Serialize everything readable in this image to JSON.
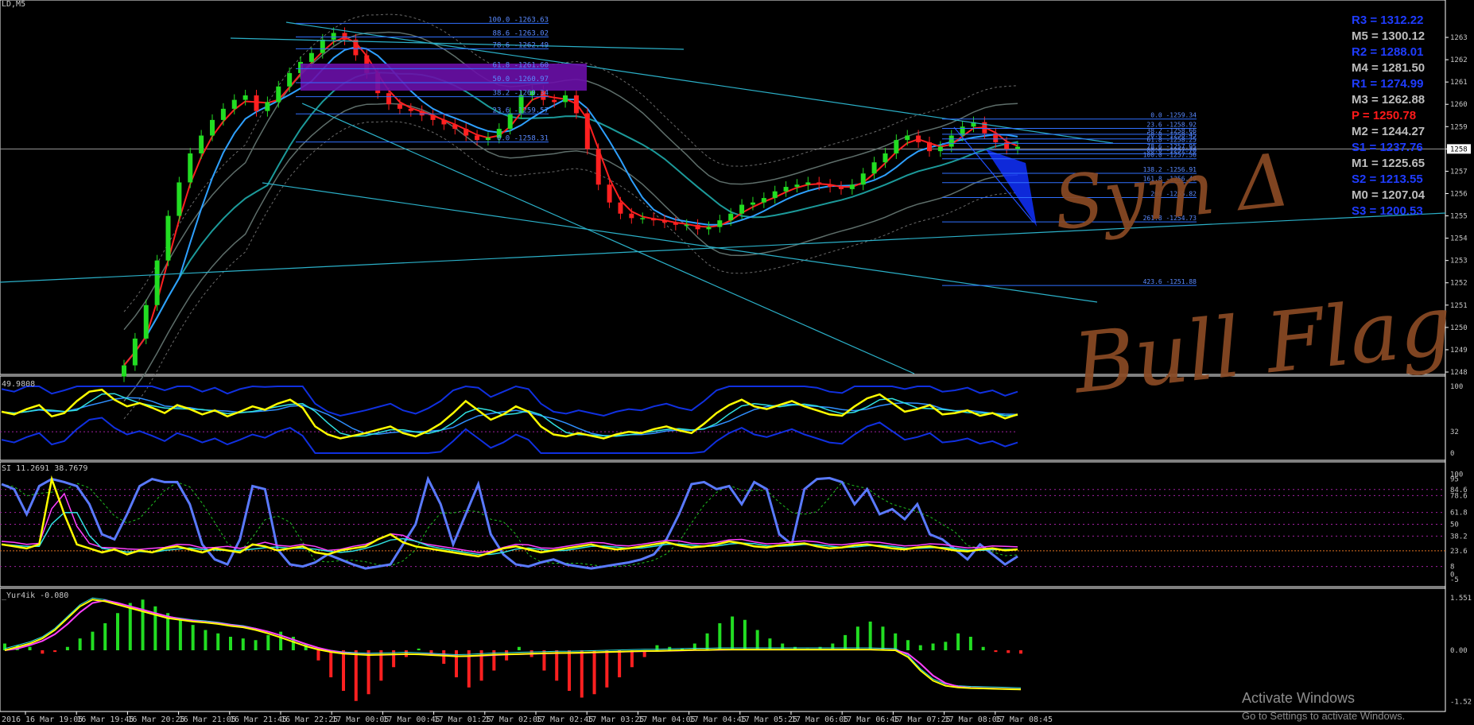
{
  "window": {
    "symbol_label": "LD,M5"
  },
  "panels": {
    "stoch_label": "49.9808",
    "rsi_label": "SI 11.2691 38.7679",
    "macd_label": "_Yur4ik -0.080"
  },
  "pivots": [
    {
      "label": "R3 = 1312.22",
      "color": "#1f3cff"
    },
    {
      "label": "M5 = 1300.12",
      "color": "#bdbdbd"
    },
    {
      "label": "R2 = 1288.01",
      "color": "#1f3cff"
    },
    {
      "label": "M4 = 1281.50",
      "color": "#bdbdbd"
    },
    {
      "label": "R1 = 1274.99",
      "color": "#1f3cff"
    },
    {
      "label": "M3 = 1262.88",
      "color": "#bdbdbd"
    },
    {
      "label": "P    = 1250.78",
      "color": "#ff1a1a"
    },
    {
      "label": "M2 = 1244.27",
      "color": "#bdbdbd"
    },
    {
      "label": "S1 = 1237.76",
      "color": "#1f3cff"
    },
    {
      "label": "M1 = 1225.65",
      "color": "#bdbdbd"
    },
    {
      "label": "S2 = 1213.55",
      "color": "#1f3cff"
    },
    {
      "label": "M0 = 1207.04",
      "color": "#bdbdbd"
    },
    {
      "label": "S3 = 1200.53",
      "color": "#1f3cff"
    }
  ],
  "annotations": {
    "line1": "Sym Δ",
    "line2": "Bull Flag"
  },
  "watermark": {
    "title": "Activate Windows",
    "subtitle": "Go to Settings to activate Windows."
  },
  "chart_data": {
    "type": "candlestick",
    "timeframe": "M5",
    "price_axis": {
      "ticks": [
        "1263",
        "1262",
        "1261",
        "1260",
        "1259",
        "1258",
        "1257",
        "1256",
        "1255",
        "1254",
        "1253",
        "1252",
        "1251",
        "1250",
        "1249",
        "1248"
      ],
      "current_price": "1258"
    },
    "time_axis": {
      "ticks": [
        "2016",
        "16 Mar 19:05",
        "16 Mar 19:45",
        "16 Mar 20:25",
        "16 Mar 21:05",
        "16 Mar 21:45",
        "16 Mar 22:25",
        "17 Mar 00:05",
        "17 Mar 00:45",
        "17 Mar 01:25",
        "17 Mar 02:05",
        "17 Mar 02:45",
        "17 Mar 03:25",
        "17 Mar 04:05",
        "17 Mar 04:45",
        "17 Mar 05:25",
        "17 Mar 06:05",
        "17 Mar 06:45",
        "17 Mar 07:25",
        "17 Mar 08:05",
        "17 Mar 08:45"
      ]
    },
    "close_path": [
      1248.3,
      1249.5,
      1251.0,
      1253.0,
      1255.0,
      1256.5,
      1257.8,
      1258.6,
      1259.3,
      1259.8,
      1260.2,
      1260.4,
      1259.7,
      1260.1,
      1260.8,
      1261.4,
      1261.9,
      1262.3,
      1262.9,
      1263.2,
      1262.9,
      1262.2,
      1261.4,
      1260.5,
      1260.0,
      1259.8,
      1259.7,
      1259.5,
      1259.3,
      1259.1,
      1258.9,
      1258.6,
      1258.4,
      1258.5,
      1258.9,
      1259.6,
      1260.4,
      1260.6,
      1260.2,
      1260.1,
      1260.4,
      1259.6,
      1258.0,
      1256.4,
      1255.6,
      1255.1,
      1254.9,
      1254.9,
      1254.8,
      1254.7,
      1254.6,
      1254.6,
      1254.4,
      1254.5,
      1254.8,
      1255.1,
      1255.5,
      1255.6,
      1255.8,
      1256.1,
      1256.3,
      1256.4,
      1256.5,
      1256.4,
      1256.3,
      1256.2,
      1256.4,
      1256.9,
      1257.4,
      1257.8,
      1258.4,
      1258.6,
      1258.3,
      1257.9,
      1258.1,
      1258.6,
      1259.0,
      1259.2,
      1258.7,
      1258.3,
      1258.0,
      1258.1
    ],
    "fibonacci_upper": [
      {
        "label": "100.0 -1263.63",
        "price": 1263.63
      },
      {
        "label": "88.6 -1263.02",
        "price": 1263.02
      },
      {
        "label": "78.6 -1262.49",
        "price": 1262.49
      },
      {
        "label": "61.8 -1261.60",
        "price": 1261.6
      },
      {
        "label": "50.0 -1260.97",
        "price": 1260.97
      },
      {
        "label": "38.2 -1260.34",
        "price": 1260.34
      },
      {
        "label": "23.6 -1259.57",
        "price": 1259.57
      },
      {
        "label": "0.0 -1258.31",
        "price": 1258.31
      }
    ],
    "fibonacci_lower": [
      {
        "label": "0.0 -1259.34",
        "price": 1259.34
      },
      {
        "label": "23.6 -1258.92",
        "price": 1258.92
      },
      {
        "label": "38.2 -1258.66",
        "price": 1258.66
      },
      {
        "label": "50.0 -1258.45",
        "price": 1258.45
      },
      {
        "label": "61.8 -1258.25",
        "price": 1258.25
      },
      {
        "label": "78.6 -1257.95",
        "price": 1257.95
      },
      {
        "label": "88.6 -1257.78",
        "price": 1257.78
      },
      {
        "label": "100.0 -1257.56",
        "price": 1257.56
      },
      {
        "label": "138.2 -1256.91",
        "price": 1256.91
      },
      {
        "label": "161.8 -1256.49",
        "price": 1256.49
      },
      {
        "label": "200 -1255.82",
        "price": 1255.82
      },
      {
        "label": "261.8 -1254.73",
        "price": 1254.73
      },
      {
        "label": "423.6 -1251.88",
        "price": 1251.88
      }
    ],
    "stoch": {
      "ticks": [
        "100",
        "32",
        "0"
      ],
      "path": [
        62,
        58,
        66,
        72,
        55,
        60,
        78,
        92,
        95,
        80,
        70,
        75,
        68,
        60,
        72,
        66,
        58,
        64,
        55,
        62,
        70,
        65,
        74,
        80,
        68,
        40,
        28,
        22,
        26,
        30,
        35,
        40,
        30,
        25,
        33,
        44,
        60,
        78,
        64,
        50,
        58,
        70,
        62,
        40,
        28,
        25,
        30,
        26,
        22,
        28,
        32,
        30,
        36,
        40,
        34,
        30,
        44,
        60,
        72,
        80,
        70,
        66,
        72,
        78,
        70,
        64,
        58,
        56,
        70,
        82,
        88,
        75,
        62,
        66,
        72,
        58,
        60,
        64,
        56,
        60,
        52,
        58
      ]
    },
    "rsi": {
      "ticks": [
        "100",
        "95",
        "84.6",
        "78.6",
        "61.8",
        "50",
        "38.2",
        "23.6",
        "8",
        "0",
        "-5"
      ],
      "path": [
        90,
        85,
        60,
        88,
        95,
        92,
        88,
        70,
        40,
        35,
        60,
        88,
        95,
        92,
        92,
        70,
        30,
        15,
        10,
        35,
        88,
        85,
        25,
        10,
        8,
        12,
        20,
        15,
        10,
        6,
        8,
        10,
        30,
        50,
        95,
        70,
        30,
        60,
        90,
        40,
        20,
        10,
        8,
        12,
        15,
        10,
        8,
        6,
        8,
        10,
        12,
        15,
        20,
        35,
        60,
        90,
        92,
        85,
        88,
        70,
        92,
        85,
        40,
        30,
        85,
        95,
        96,
        92,
        70,
        85,
        60,
        65,
        55,
        70,
        40,
        35,
        25,
        15,
        30,
        20,
        10,
        18
      ],
      "yellow": [
        30,
        28,
        26,
        30,
        95,
        60,
        30,
        26,
        22,
        25,
        20,
        24,
        22,
        26,
        28,
        25,
        22,
        26,
        24,
        22,
        30,
        28,
        24,
        26,
        28,
        22,
        20,
        24,
        26,
        28,
        35,
        40,
        32,
        28,
        26,
        24,
        22,
        20,
        18,
        22,
        26,
        28,
        25,
        22,
        24,
        26,
        28,
        30,
        27,
        25,
        26,
        28,
        30,
        32,
        29,
        27,
        28,
        30,
        33,
        31,
        28,
        27,
        29,
        30,
        31,
        28,
        26,
        27,
        29,
        30,
        28,
        26,
        25,
        27,
        28,
        26,
        24,
        23,
        25,
        26,
        24,
        25
      ]
    },
    "macd": {
      "ticks": [
        "1.551",
        "0.00",
        "-1.52"
      ],
      "histogram": [
        0.2,
        0.15,
        0.1,
        -0.1,
        -0.05,
        0.1,
        0.35,
        0.55,
        0.8,
        1.1,
        1.4,
        1.5,
        1.3,
        1.1,
        0.9,
        0.75,
        0.6,
        0.5,
        0.4,
        0.35,
        0.3,
        0.45,
        0.55,
        0.4,
        0.2,
        -0.3,
        -0.8,
        -1.2,
        -1.5,
        -1.3,
        -0.9,
        -0.5,
        -0.2,
        0.05,
        -0.1,
        -0.4,
        -0.8,
        -1.1,
        -0.9,
        -0.6,
        -0.3,
        0.1,
        -0.2,
        -0.6,
        -0.9,
        -1.2,
        -1.4,
        -1.3,
        -1.1,
        -0.8,
        -0.5,
        -0.2,
        0.15,
        0.1,
        0.05,
        0.2,
        0.5,
        0.8,
        1.0,
        0.9,
        0.6,
        0.35,
        0.2,
        0.1,
        0.05,
        0.1,
        0.2,
        0.45,
        0.7,
        0.85,
        0.7,
        0.5,
        0.3,
        0.15,
        0.2,
        0.25,
        0.5,
        0.4,
        0.1,
        -0.05,
        -0.08,
        -0.1
      ],
      "signal": [
        0.0,
        0.1,
        0.2,
        0.35,
        0.6,
        0.95,
        1.3,
        1.5,
        1.45,
        1.35,
        1.25,
        1.15,
        1.05,
        0.95,
        0.9,
        0.85,
        0.82,
        0.78,
        0.72,
        0.68,
        0.6,
        0.5,
        0.38,
        0.25,
        0.12,
        0.02,
        -0.05,
        -0.1,
        -0.12,
        -0.14,
        -0.13,
        -0.12,
        -0.11,
        -0.12,
        -0.14,
        -0.16,
        -0.18,
        -0.17,
        -0.15,
        -0.13,
        -0.12,
        -0.11,
        -0.1,
        -0.09,
        -0.08,
        -0.08,
        -0.07,
        -0.06,
        -0.05,
        -0.04,
        -0.03,
        -0.02,
        -0.02,
        -0.01,
        0.0,
        0.01,
        0.01,
        0.02,
        0.02,
        0.02,
        0.02,
        0.02,
        0.02,
        0.02,
        0.02,
        0.02,
        0.02,
        0.02,
        0.02,
        0.02,
        0.01,
        0.0,
        -0.2,
        -0.6,
        -0.9,
        -1.05,
        -1.1,
        -1.12,
        -1.13,
        -1.14,
        -1.15,
        -1.16
      ]
    }
  }
}
